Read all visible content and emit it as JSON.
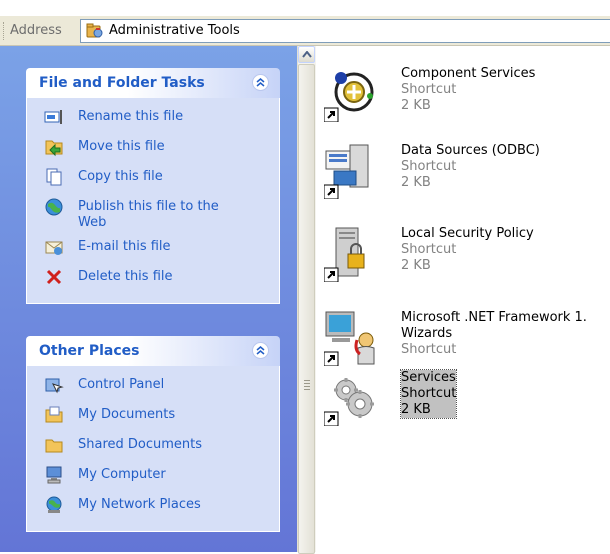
{
  "address": {
    "label": "Address",
    "value": "Administrative Tools"
  },
  "panels": {
    "file_tasks": {
      "title": "File and Folder Tasks",
      "items": [
        {
          "label": "Rename this file",
          "icon": "rename-icon"
        },
        {
          "label": "Move this file",
          "icon": "move-icon"
        },
        {
          "label": "Copy this file",
          "icon": "copy-icon"
        },
        {
          "label": "Publish this file to the Web",
          "icon": "publish-icon"
        },
        {
          "label": "E-mail this file",
          "icon": "email-icon"
        },
        {
          "label": "Delete this file",
          "icon": "delete-icon"
        }
      ]
    },
    "other_places": {
      "title": "Other Places",
      "items": [
        {
          "label": "Control Panel",
          "icon": "control-panel-icon"
        },
        {
          "label": "My Documents",
          "icon": "my-documents-icon"
        },
        {
          "label": "Shared Documents",
          "icon": "shared-documents-icon"
        },
        {
          "label": "My Computer",
          "icon": "my-computer-icon"
        },
        {
          "label": "My Network Places",
          "icon": "network-places-icon"
        }
      ]
    }
  },
  "files": [
    {
      "name": "Component Services",
      "type": "Shortcut",
      "size": "2 KB",
      "icon": "component-services-icon"
    },
    {
      "name": "Data Sources (ODBC)",
      "type": "Shortcut",
      "size": "2 KB",
      "icon": "data-sources-icon"
    },
    {
      "name": "Local Security Policy",
      "type": "Shortcut",
      "size": "2 KB",
      "icon": "local-security-policy-icon"
    },
    {
      "name": "Microsoft .NET Framework 1.",
      "name2": "Wizards",
      "type": "Shortcut",
      "icon": "net-framework-wizards-icon"
    },
    {
      "name": "Services",
      "type": "Shortcut",
      "size": "2 KB",
      "icon": "services-icon",
      "selected": true
    }
  ],
  "colors": {
    "link": "#215dc6",
    "pane_top": "#7ba2e7",
    "pane_bottom": "#6375d6",
    "panel_body": "#d6dff7",
    "subtext": "#828282"
  }
}
